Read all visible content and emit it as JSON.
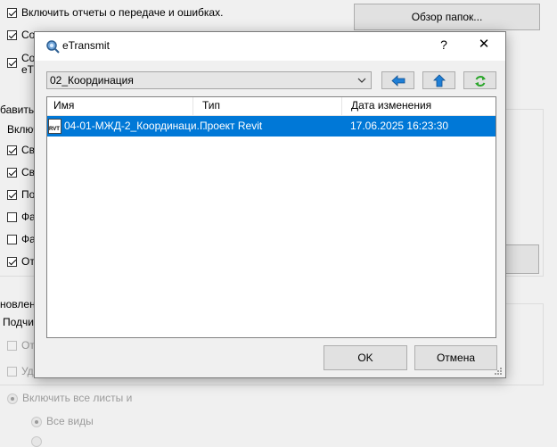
{
  "background": {
    "checkboxes": [
      {
        "label": "Включить отчеты о передаче и ошибках.",
        "checked": true
      },
      {
        "label": "Со",
        "checked": true
      },
      {
        "label": "Со",
        "label2": "eTr",
        "checked": true
      }
    ],
    "browse_button": "Обзор папок...",
    "group_label": "бавить",
    "include_label": "Включ",
    "group_checks": [
      {
        "label": "Св",
        "checked": true
      },
      {
        "label": "Св",
        "checked": true
      },
      {
        "label": "По",
        "checked": true
      },
      {
        "label": "Фа",
        "checked": false
      },
      {
        "label": "Фа",
        "checked": false
      },
      {
        "label": "От",
        "checked": true
      }
    ],
    "group2_label": "новлени",
    "subfolder_label": "Подчис",
    "disabled_checks": [
      {
        "label": "От"
      },
      {
        "label": "Уд"
      }
    ],
    "radio_all_sheets": "Включить все листы и",
    "radio_all_views": "Все виды"
  },
  "dialog": {
    "title": "eTransmit",
    "help_symbol": "?",
    "close_symbol": "✕",
    "folder_combo": "02_Координация",
    "nav_icons": [
      "back-arrow-icon",
      "up-arrow-icon",
      "refresh-icon"
    ],
    "columns": [
      "Имя",
      "Тип",
      "Дата изменения"
    ],
    "rows": [
      {
        "icon_text": "RVT",
        "name": "04-01-МЖД-2_Координаци...",
        "type": "Проект Revit",
        "date": "17.06.2025 16:23:30",
        "selected": true
      }
    ],
    "ok_label": "OK",
    "cancel_label": "Отмена"
  },
  "colors": {
    "accent_selection": "#0078d7",
    "nav_arrow_blue": "#1f7fd6",
    "refresh_green": "#2aa52a"
  }
}
